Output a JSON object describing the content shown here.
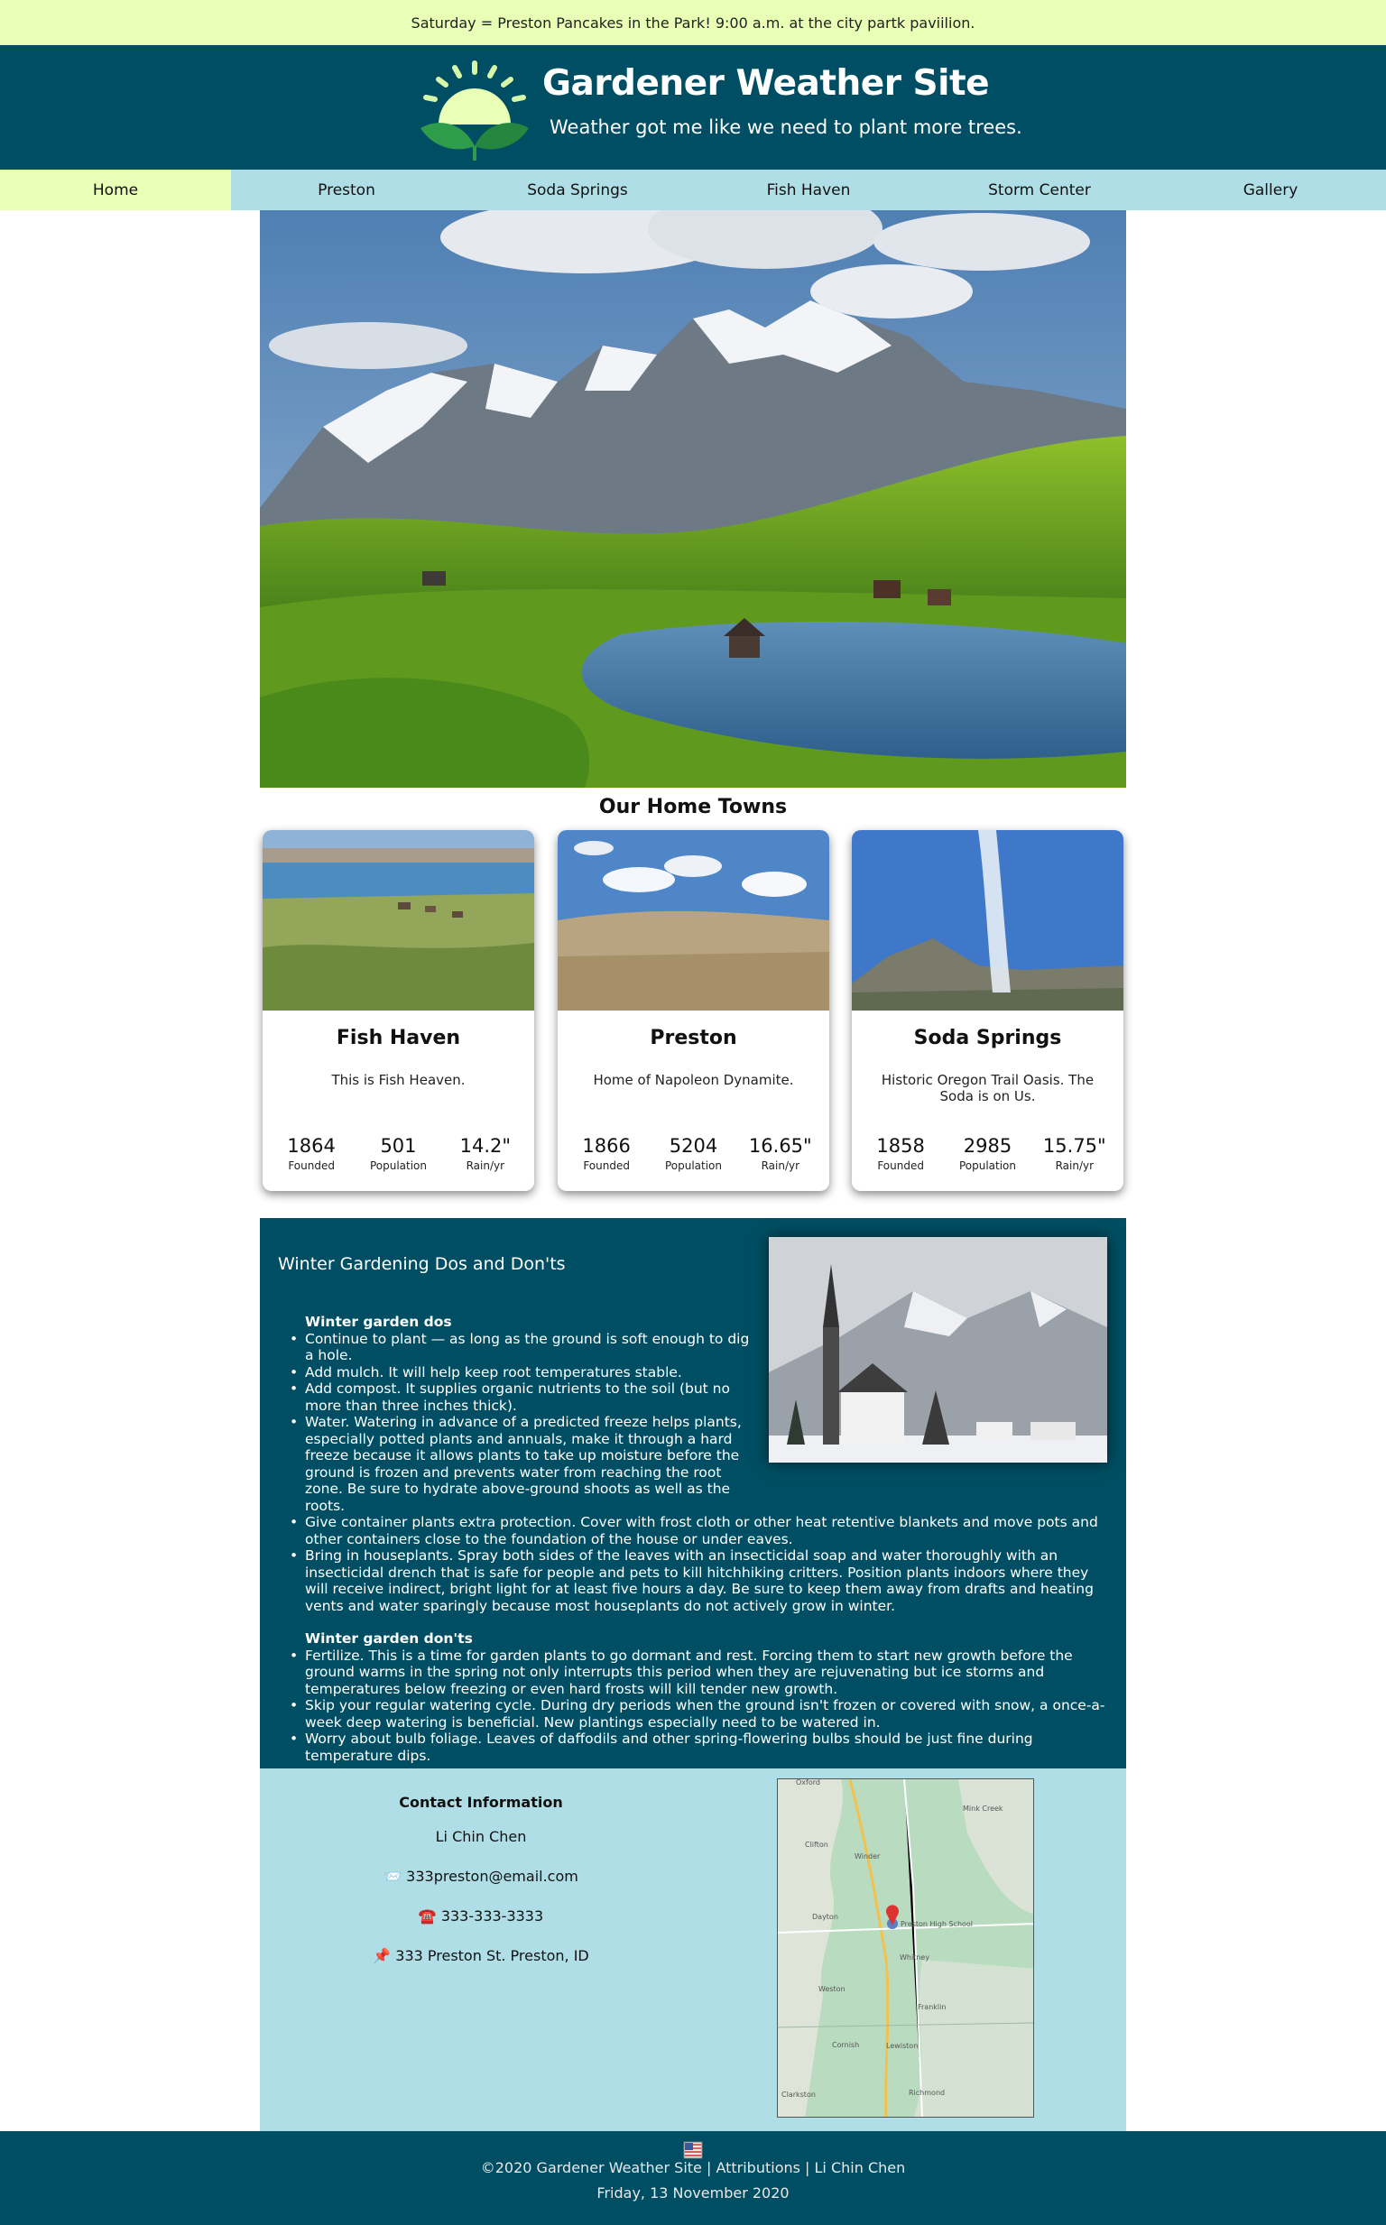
{
  "banner": {
    "text": "Saturday = Preston Pancakes in the Park! 9:00 a.m. at the city partk paviilion."
  },
  "header": {
    "title": "Gardener Weather Site",
    "tagline": "Weather got me like we need to plant more trees."
  },
  "nav": {
    "items": [
      {
        "label": "Home",
        "active": true
      },
      {
        "label": "Preston",
        "active": false
      },
      {
        "label": "Soda Springs",
        "active": false
      },
      {
        "label": "Fish Haven",
        "active": false
      },
      {
        "label": "Storm Center",
        "active": false
      },
      {
        "label": "Gallery",
        "active": false
      }
    ]
  },
  "hometowns": {
    "title": "Our Home Towns",
    "towns": [
      {
        "name": "Fish Haven",
        "description": "This is Fish Heaven.",
        "founded": "1864",
        "population": "501",
        "rain": "14.2\""
      },
      {
        "name": "Preston",
        "description": "Home of Napoleon Dynamite.",
        "founded": "1866",
        "population": "5204",
        "rain": "16.65\""
      },
      {
        "name": "Soda Springs",
        "description": "Historic Oregon Trail Oasis. The Soda is on Us.",
        "founded": "1858",
        "population": "2985",
        "rain": "15.75\""
      }
    ],
    "stat_labels": {
      "founded": "Founded",
      "population": "Population",
      "rain": "Rain/yr"
    }
  },
  "winter": {
    "title": "Winter Gardening Dos and Don'ts",
    "dos_heading": "Winter garden dos",
    "dos": [
      "Continue to plant — as long as the ground is soft enough to dig a hole.",
      "Add mulch. It will help keep root temperatures stable.",
      "Add compost. It supplies organic nutrients to the soil (but no more than three inches thick).",
      "Water. Watering in advance of a predicted freeze helps plants, especially potted plants and annuals, make it through a hard freeze because it allows plants to take up moisture before the ground is frozen and prevents water from reaching the root zone. Be sure to hydrate above-ground shoots as well as the roots.",
      "Give container plants extra protection. Cover with frost cloth or other heat retentive blankets and move pots and other containers close to the foundation of the house or under eaves.",
      "Bring in houseplants. Spray both sides of the leaves with an insecticidal soap and water thoroughly with an insecticidal drench that is safe for people and pets to kill hitchhiking critters. Position plants indoors where they will receive indirect, bright light for at least five hours a day. Be sure to keep them away from drafts and heating vents and water sparingly because most houseplants do not actively grow in winter."
    ],
    "donts_heading": "Winter garden don'ts",
    "donts": [
      "Fertilize. This is a time for garden plants to go dormant and rest. Forcing them to start new growth before the ground warms in the spring not only interrupts this period when they are rejuvenating but ice storms and temperatures below freezing or even hard frosts will kill tender new growth.",
      "Skip your regular watering cycle. During dry periods when the ground isn't frozen or covered with snow, a once-a-week deep watering is beneficial. New plantings especially need to be watered in.",
      "Worry about bulb foliage. Leaves of daffodils and other spring-flowering bulbs should be just fine during temperature dips."
    ]
  },
  "contact": {
    "title": "Contact Information",
    "name": "Li Chin Chen",
    "email": "📨 333preston@email.com",
    "phone": "☎️ 333-333-3333",
    "address": "📌 333 Preston St. Preston, ID"
  },
  "map": {
    "labels": [
      "Oxford",
      "Mink Creek",
      "Clifton",
      "Winder",
      "Dayton",
      "Preston High School",
      "Whitney",
      "Weston",
      "Franklin",
      "Cornish",
      "Lewiston",
      "Clarkston",
      "Richmond"
    ]
  },
  "footer": {
    "copyright": "©2020 Gardener Weather Site | Attributions | Li Chin Chen",
    "date": "Friday, 13 November 2020"
  },
  "colors": {
    "accent_dark": "#004e63",
    "accent_light": "#b0dee7",
    "highlight": "#e9ffb6"
  }
}
